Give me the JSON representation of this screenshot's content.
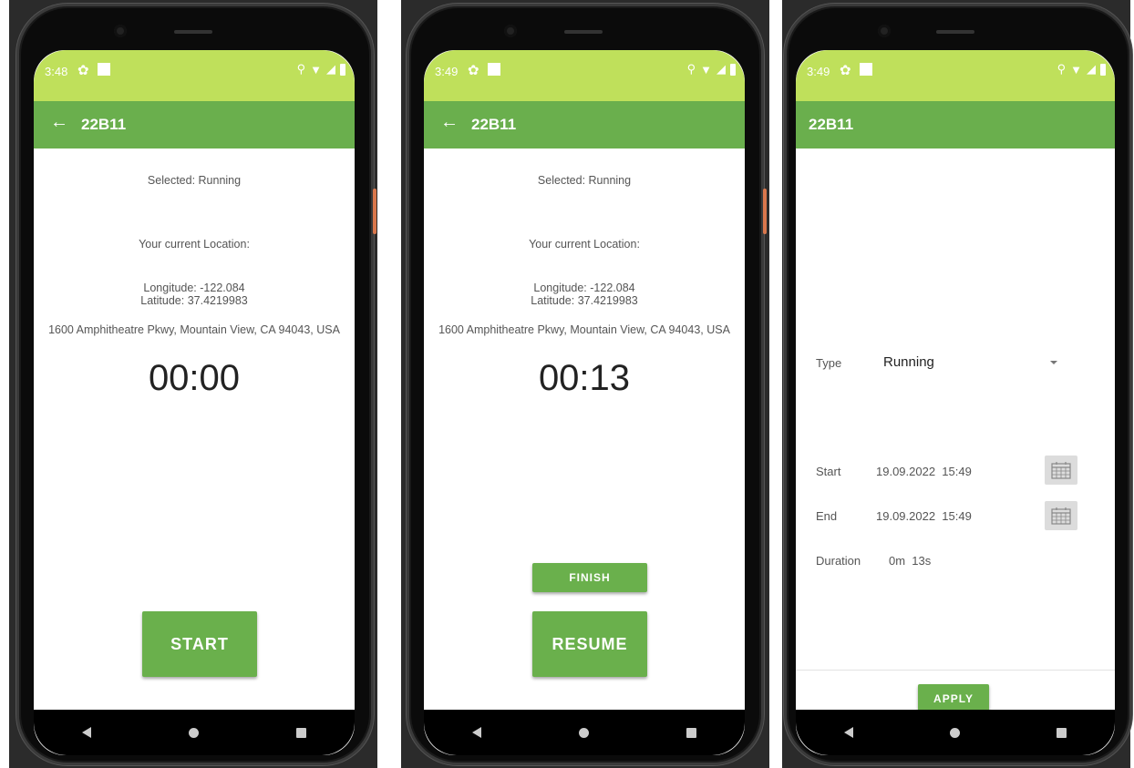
{
  "screens": [
    {
      "status_time": "3:48",
      "app_title": "22B11",
      "selected_text": "Selected: Running",
      "location_heading": "Your current Location:",
      "longitude": "Longitude: -122.084",
      "latitude": "Latitude: 37.4219983",
      "address": "1600 Amphitheatre Pkwy, Mountain View, CA 94043, USA",
      "timer": "00:00",
      "start_label": "START"
    },
    {
      "status_time": "3:49",
      "app_title": "22B11",
      "selected_text": "Selected: Running",
      "location_heading": "Your current Location:",
      "longitude": "Longitude: -122.084",
      "latitude": "Latitude: 37.4219983",
      "address": "1600 Amphitheatre Pkwy, Mountain View, CA 94043, USA",
      "timer": "00:13",
      "finish_label": "FINISH",
      "resume_label": "RESUME"
    },
    {
      "status_time": "3:49",
      "app_title": "22B11",
      "type_label": "Type",
      "type_value": "Running",
      "start_label": "Start",
      "start_value": "19.09.2022  15:49",
      "end_label": "End",
      "end_value": "19.09.2022  15:49",
      "duration_label": "Duration",
      "duration_value": "0m  13s",
      "apply_label": "APPLY"
    }
  ],
  "icons": {
    "back": "arrow-left-icon",
    "settings": "gear-icon",
    "location": "location-pin-icon",
    "wifi": "wifi-icon",
    "signal": "signal-icon",
    "battery": "battery-icon",
    "calendar": "calendar-icon",
    "nav_back": "nav-back-icon",
    "nav_home": "nav-home-icon",
    "nav_recent": "nav-recent-icon"
  },
  "colors": {
    "status_bar": "#bfe05b",
    "app_bar": "#6aaf4d",
    "button": "#6ab04c"
  }
}
